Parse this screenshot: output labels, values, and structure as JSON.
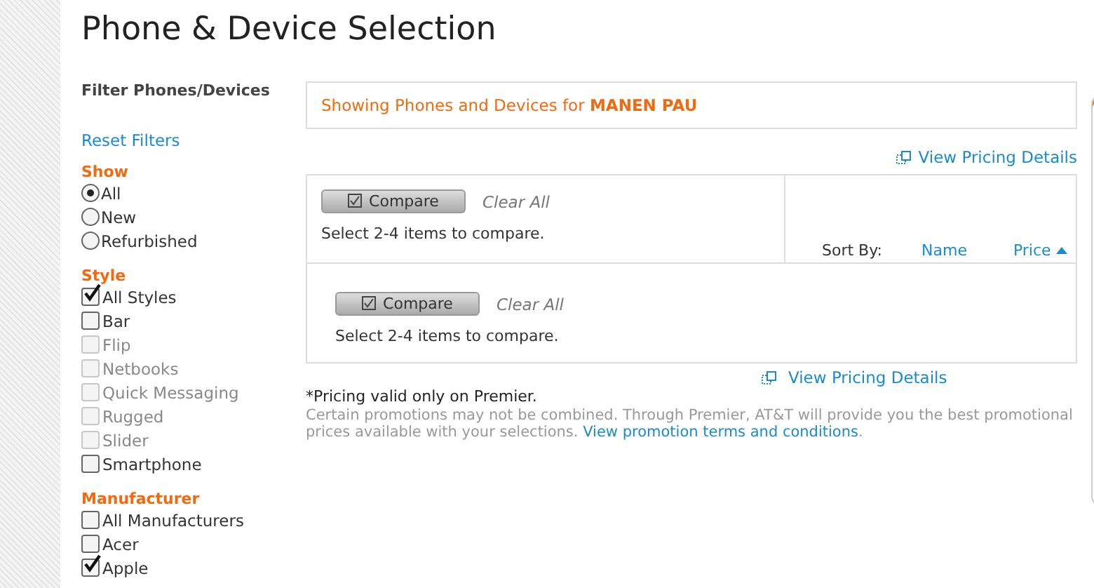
{
  "page_title": "Phone & Device Selection",
  "sidebar": {
    "heading": "Filter Phones/Devices",
    "reset_link": "Reset Filters",
    "groups": [
      {
        "title": "Show",
        "kind": "radio",
        "options": [
          {
            "label": "All",
            "selected": true,
            "disabled": false
          },
          {
            "label": "New",
            "selected": false,
            "disabled": false
          },
          {
            "label": "Refurbished",
            "selected": false,
            "disabled": false
          }
        ]
      },
      {
        "title": "Style",
        "kind": "checkbox",
        "options": [
          {
            "label": "All Styles",
            "checked": true,
            "disabled": false
          },
          {
            "label": "Bar",
            "checked": false,
            "disabled": false
          },
          {
            "label": "Flip",
            "checked": false,
            "disabled": true
          },
          {
            "label": "Netbooks",
            "checked": false,
            "disabled": true
          },
          {
            "label": "Quick Messaging",
            "checked": false,
            "disabled": true
          },
          {
            "label": "Rugged",
            "checked": false,
            "disabled": true
          },
          {
            "label": "Slider",
            "checked": false,
            "disabled": true
          },
          {
            "label": "Smartphone",
            "checked": false,
            "disabled": false
          }
        ]
      },
      {
        "title": "Manufacturer",
        "kind": "checkbox",
        "options": [
          {
            "label": "All Manufacturers",
            "checked": false,
            "disabled": false
          },
          {
            "label": "Acer",
            "checked": false,
            "disabled": false
          },
          {
            "label": "Apple",
            "checked": true,
            "disabled": false
          }
        ]
      }
    ]
  },
  "banner": "Showing Phones and Devices for **MANEN PAU**",
  "pricing_link_top": "View Pricing Details",
  "compare_top": {
    "button": "Compare",
    "clear": "Clear All",
    "hint": "Select 2-4 items to compare."
  },
  "sort": {
    "label": "Sort By:",
    "options": [
      {
        "label": "Name",
        "selected": false
      },
      {
        "label": "Price",
        "selected": true
      }
    ]
  },
  "compare_bottom": {
    "button": "Compare",
    "clear": "Clear All",
    "hint": "Select 2-4 items to compare."
  },
  "pricing_link_bottom": "View Pricing Details",
  "pricing_note": "*Pricing valid only on Premier.",
  "promo_text": "Certain promotions may not be combined. Through Premier, AT&T will provide you the best promotional prices available with your selections.",
  "promo_link": "View promotion terms and conditions",
  "promo_end": "."
}
